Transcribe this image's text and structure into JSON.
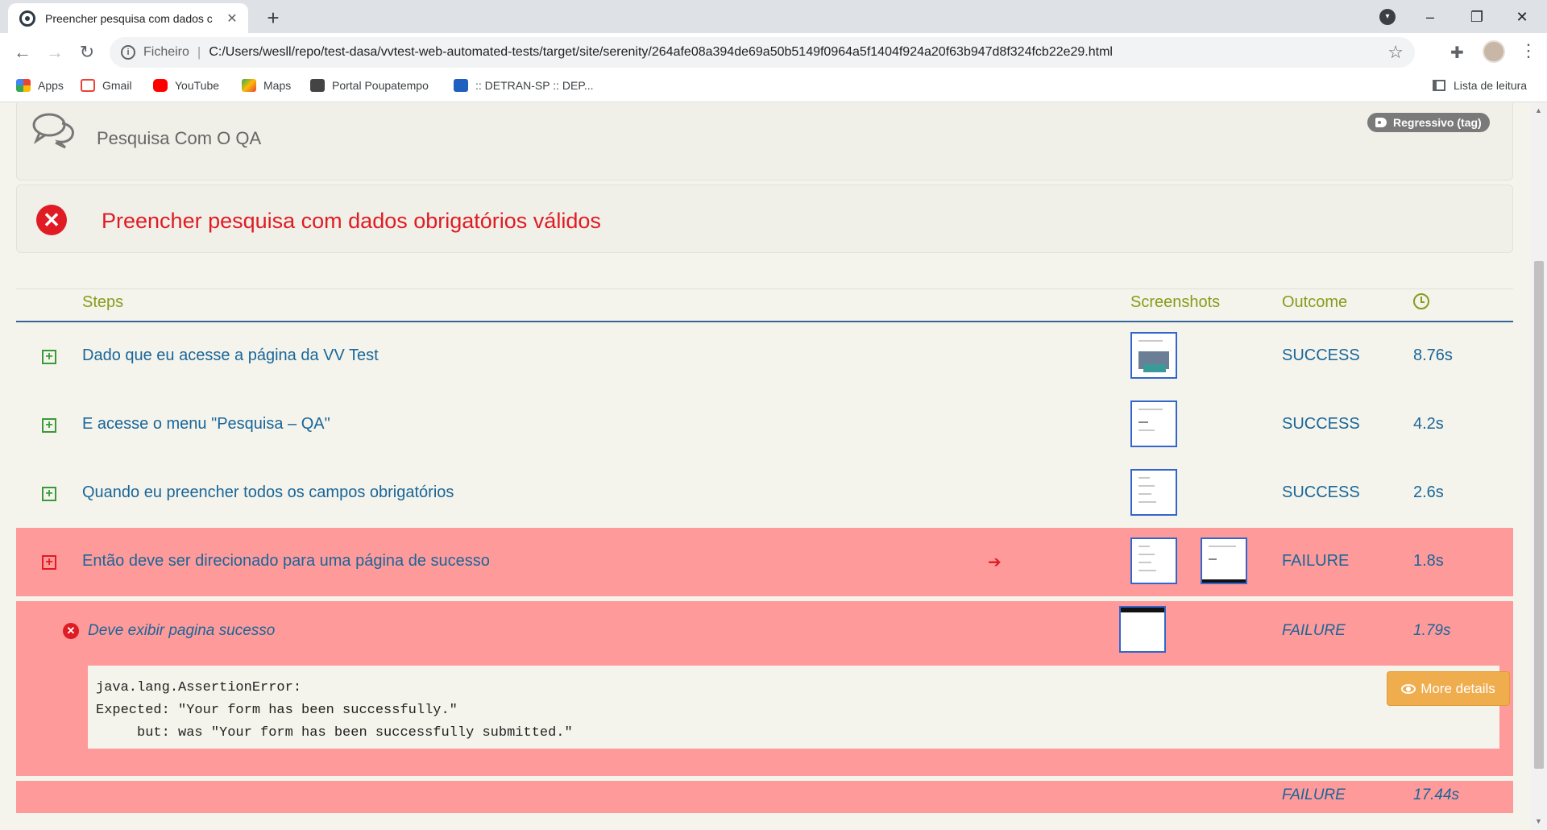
{
  "browser": {
    "tab_title": "Preencher pesquisa com dados c",
    "tab_close": "✕",
    "new_tab": "+",
    "scheme_label": "Ficheiro",
    "separator": "|",
    "url": "C:/Users/wesll/repo/test-dasa/vvtest-web-automated-tests/target/site/serenity/264afe08a394de69a50b5149f0964a5f1404f924a20f63b947d8f324fcb22e29.html",
    "bookmarks": [
      {
        "label": "Apps",
        "icon": "apps-grid-icon",
        "color": "#4285f4"
      },
      {
        "label": "Gmail",
        "icon": "gmail-icon",
        "color": "#ea4335"
      },
      {
        "label": "YouTube",
        "icon": "youtube-icon",
        "color": "#ff0000"
      },
      {
        "label": "Maps",
        "icon": "maps-icon",
        "color": "#34a853"
      },
      {
        "label": "Portal Poupatempo",
        "icon": "poupatempo-icon",
        "color": "#444444"
      },
      {
        "label": ":: DETRAN-SP :: DEP...",
        "icon": "detran-icon",
        "color": "#1f5fbf"
      }
    ],
    "reading_list": "Lista de leitura"
  },
  "report": {
    "story_title": "Pesquisa Com O QA",
    "tag": "Regressivo (tag)",
    "scenario_title": "Preencher pesquisa com dados obrigatórios válidos",
    "columns": {
      "steps": "Steps",
      "screenshots": "Screenshots",
      "outcome": "Outcome"
    },
    "steps": [
      {
        "text": "Dado que eu acesse a página da VV Test",
        "outcome": "SUCCESS",
        "duration": "8.76s"
      },
      {
        "text": "E acesse o menu \"Pesquisa – QA\"",
        "outcome": "SUCCESS",
        "duration": "4.2s"
      },
      {
        "text": "Quando eu preencher todos os campos obrigatórios",
        "outcome": "SUCCESS",
        "duration": "2.6s"
      },
      {
        "text": "Então deve ser direcionado para uma página de sucesso",
        "outcome": "FAILURE",
        "duration": "1.8s"
      }
    ],
    "sub_step": {
      "text": "Deve exibir pagina sucesso",
      "outcome": "FAILURE",
      "duration": "1.79s",
      "error_lines": [
        "java.lang.AssertionError:",
        "Expected: \"Your form has been successfully.\"",
        "     but: was \"Your form has been successfully submitted.\""
      ],
      "more_details": "More details"
    },
    "total": {
      "outcome": "FAILURE",
      "duration": "17.44s"
    },
    "colors": {
      "failure_bg": "#ff9a9a",
      "accent": "#8a9a1a",
      "link": "#1a6699",
      "error_red": "#e01b24",
      "button": "#f0ad4e"
    }
  }
}
